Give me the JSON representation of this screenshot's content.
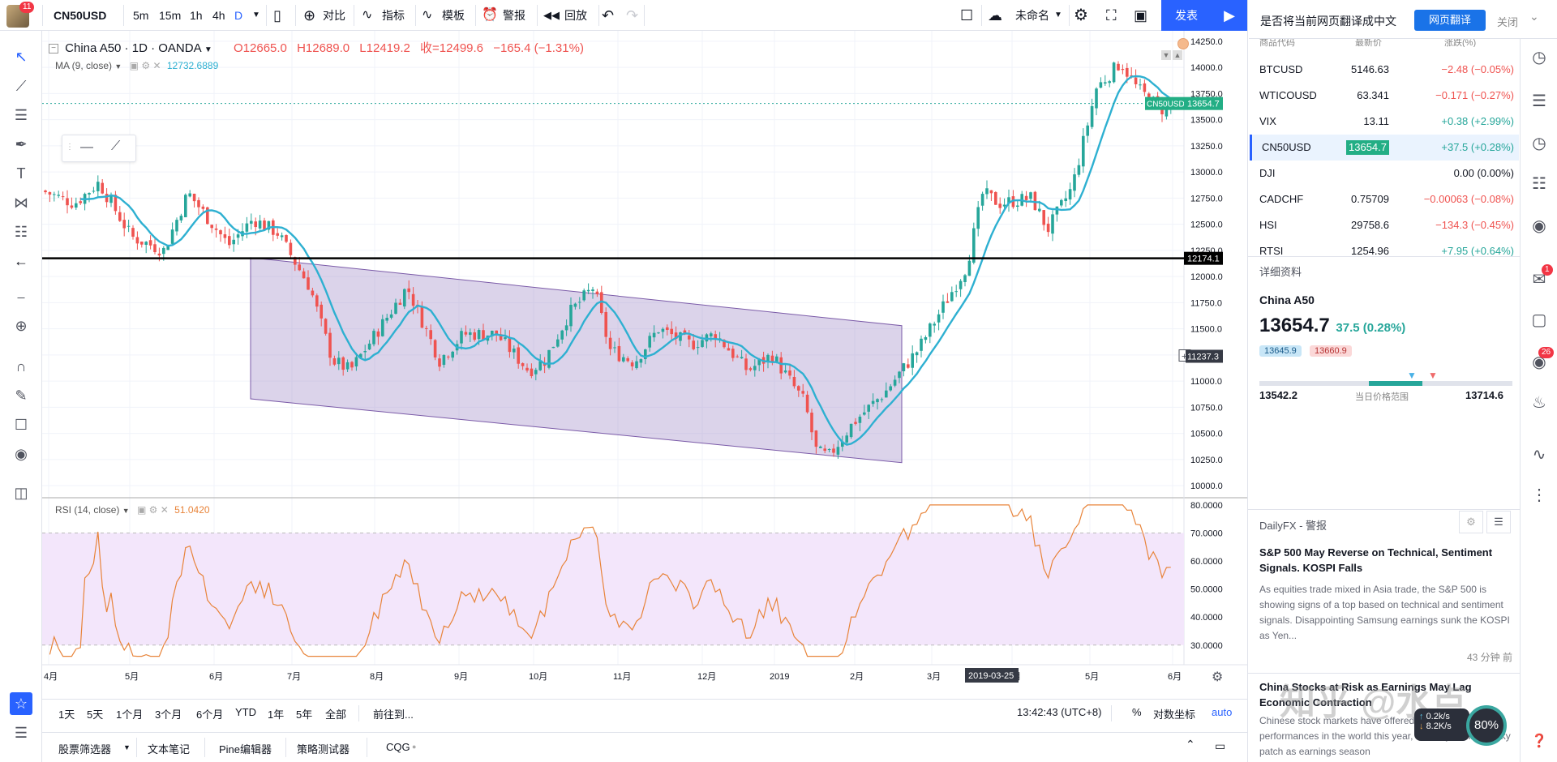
{
  "topbar": {
    "avatar_badge": "11",
    "symbol": "CN50USD",
    "intervals": [
      "5m",
      "15m",
      "1h",
      "4h",
      "D"
    ],
    "compare": "对比",
    "indicators": "指标",
    "templates": "模板",
    "alert": "警报",
    "replay": "回放",
    "layout_name": "未命名",
    "publish": "发表",
    "translate_prompt": "是否将当前网页翻译成中文",
    "translate_button": "网页翻译",
    "translate_close": "关闭"
  },
  "legend": {
    "title": "China A50 · 1D · OANDA",
    "open": "O12665.0",
    "high": "H12689.0",
    "low": "L12419.2",
    "close": "收=12499.6",
    "change": "−165.4 (−1.31%)",
    "ma_label": "MA (9, close)",
    "ma_value": "12732.6889",
    "rsi_label": "RSI (14, close)",
    "rsi_value": "51.0420"
  },
  "price_axis": {
    "ticks": [
      "14250.0",
      "14000.0",
      "13750.0",
      "13500.0",
      "13250.0",
      "13000.0",
      "12750.0",
      "12500.0",
      "12250.0",
      "12000.0",
      "11750.0",
      "11500.0",
      "11250.0",
      "11000.0",
      "10750.0",
      "10500.0",
      "10250.0",
      "10000.0"
    ],
    "last_label": "CN50USD",
    "last_value": "13654.7",
    "hline_value": "12174.1",
    "cursor_value": "11237.3"
  },
  "rsi_axis": {
    "ticks": [
      "80.0000",
      "70.0000",
      "60.0000",
      "50.0000",
      "40.0000",
      "30.0000"
    ]
  },
  "time_axis": {
    "labels": [
      "4月",
      "5月",
      "6月",
      "7月",
      "8月",
      "9月",
      "10月",
      "11月",
      "12月",
      "2019",
      "2月",
      "3月",
      "4月",
      "5月",
      "6月"
    ],
    "cursor_date": "2019-03-25"
  },
  "bottombar": {
    "ranges": [
      "1天",
      "5天",
      "1个月",
      "3个月",
      "6个月",
      "YTD",
      "1年",
      "5年",
      "全部"
    ],
    "goto": "前往到...",
    "clock": "13:42:43 (UTC+8)",
    "percent": "%",
    "log": "对数坐标",
    "auto": "auto"
  },
  "tabs": {
    "items": [
      "股票筛选器",
      "文本笔记",
      "Pine编辑器",
      "策略测试器",
      "CQG"
    ]
  },
  "watchlist": {
    "header_symbol": "商品代码",
    "header_last": "最新价",
    "header_change": "涨跌(%)",
    "rows": [
      {
        "symbol": "BTCUSD",
        "last": "5146.63",
        "change": "−2.48 (−0.05%)",
        "dir": "down"
      },
      {
        "symbol": "WTICOUSD",
        "last": "63.341",
        "change": "−0.171 (−0.27%)",
        "dir": "down"
      },
      {
        "symbol": "VIX",
        "last": "13.11",
        "change": "+0.38 (+2.99%)",
        "dir": "up"
      },
      {
        "symbol": "CN50USD",
        "last": "13654.7",
        "change": "+37.5 (+0.28%)",
        "dir": "up"
      },
      {
        "symbol": "DJI",
        "last": "",
        "change": "0.00 (0.00%)",
        "dir": "flat"
      },
      {
        "symbol": "CADCHF",
        "last": "0.75709",
        "change": "−0.00063 (−0.08%)",
        "dir": "down"
      },
      {
        "symbol": "HSI",
        "last": "29758.6",
        "change": "−134.3 (−0.45%)",
        "dir": "down"
      },
      {
        "symbol": "RTSI",
        "last": "1254.96",
        "change": "+7.95 (+0.64%)",
        "dir": "up"
      }
    ]
  },
  "details": {
    "header": "详细资料",
    "name": "China A50",
    "price": "13654.7",
    "change": "37.5 (0.28%)",
    "bid": "13645.9",
    "ask": "13660.9",
    "range_low": "13542.2",
    "range_label": "当日价格范围",
    "range_high": "13714.6"
  },
  "news": {
    "header": "DailyFX - 警报",
    "item1_title": "S&P 500 May Reverse on Technical, Sentiment Signals. KOSPI Falls",
    "item1_body": "As equities trade mixed in Asia trade, the S&P 500 is showing signs of a top based on technical and sentiment signals. Disappointing Samsung earnings sunk the KOSPI as Yen...",
    "item1_time": "43 分钟 前",
    "item2_title": "China Stocks at Risk as Earnings May Lag Economic Contraction",
    "item2_body": "Chinese stock markets have offered one of the best performances in the world this year, but they've hit a sticky patch as earnings season"
  },
  "overlay": {
    "watermark": "知乎 @水点",
    "net_up": "0.2k/s",
    "net_down": "8.2K/s",
    "gauge": "80%"
  },
  "rightbar": {
    "badge_chat": "1",
    "badge_ideas": "26"
  },
  "colors": {
    "up": "#26a69a",
    "down": "#ef5350",
    "ma": "#2eb0d1",
    "rsi": "#e8843a",
    "channel": "#7b5ba8",
    "accent": "#2962ff",
    "highlight": "#23ae85"
  }
}
